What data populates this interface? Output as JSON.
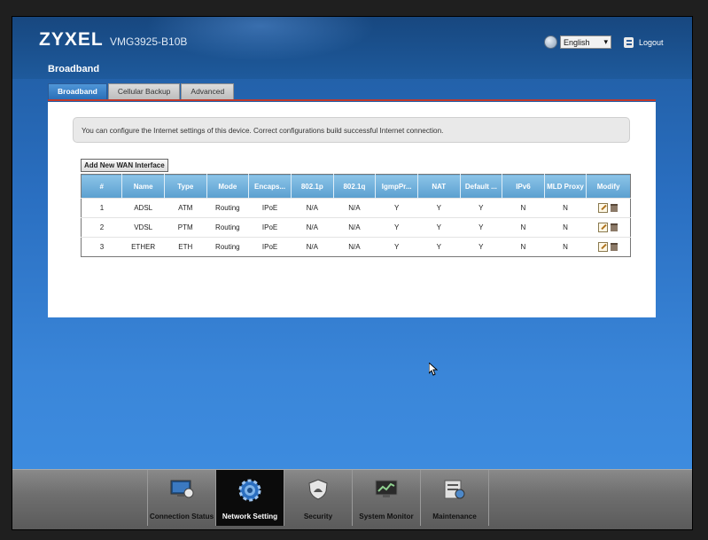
{
  "header": {
    "brand": "ZYXEL",
    "model": "VMG3925-B10B",
    "language": "English",
    "logout_label": "Logout"
  },
  "page": {
    "title": "Broadband",
    "tabs": [
      {
        "label": "Broadband",
        "active": true
      },
      {
        "label": "Cellular Backup",
        "active": false
      },
      {
        "label": "Advanced",
        "active": false
      }
    ],
    "info": "You can configure the Internet settings of this device. Correct configurations build successful Internet connection.",
    "add_button": "Add New WAN Interface"
  },
  "table": {
    "columns": [
      "#",
      "Name",
      "Type",
      "Mode",
      "Encaps...",
      "802.1p",
      "802.1q",
      "IgmpPr...",
      "NAT",
      "Default ...",
      "IPv6",
      "MLD Proxy",
      "Modify"
    ],
    "rows": [
      [
        "1",
        "ADSL",
        "ATM",
        "Routing",
        "IPoE",
        "N/A",
        "N/A",
        "Y",
        "Y",
        "Y",
        "N",
        "N"
      ],
      [
        "2",
        "VDSL",
        "PTM",
        "Routing",
        "IPoE",
        "N/A",
        "N/A",
        "Y",
        "Y",
        "Y",
        "N",
        "N"
      ],
      [
        "3",
        "ETHER",
        "ETH",
        "Routing",
        "IPoE",
        "N/A",
        "N/A",
        "Y",
        "Y",
        "Y",
        "N",
        "N"
      ]
    ]
  },
  "bottom_nav": [
    {
      "label": "Connection Status",
      "icon": "connection-status-icon",
      "active": false
    },
    {
      "label": "Network Setting",
      "icon": "network-setting-icon",
      "active": true
    },
    {
      "label": "Security",
      "icon": "security-icon",
      "active": false
    },
    {
      "label": "System Monitor",
      "icon": "system-monitor-icon",
      "active": false
    },
    {
      "label": "Maintenance",
      "icon": "maintenance-icon",
      "active": false
    }
  ],
  "colors": {
    "accent": "#2a6fb8",
    "tab_underline": "#c0392b",
    "table_header": "#5a9fcf"
  }
}
